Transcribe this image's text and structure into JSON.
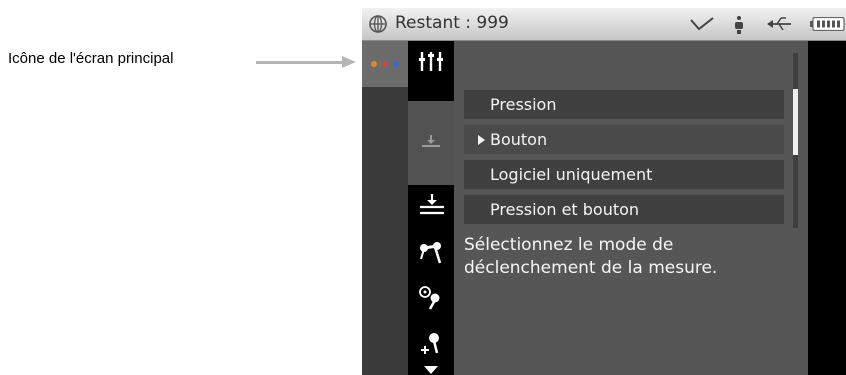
{
  "callout": {
    "label": "Icône de l'écran principal"
  },
  "statusbar": {
    "title": "Restant : 999",
    "icons": [
      "globe-icon",
      "check-icon",
      "sensor-icon",
      "usb-icon",
      "battery-icon"
    ]
  },
  "toolbar": {
    "home_icon": "three-dots-icon",
    "dot_colors": [
      "#e08a2e",
      "#c94848",
      "#3d66c8"
    ]
  },
  "subbar": {
    "icons": [
      "sliders-icon",
      "trend-icon",
      "trigger-icon",
      "trigger-selected-icon",
      "probe-icon",
      "probe-settings-icon",
      "probe-add-icon",
      "down-arrow-icon"
    ]
  },
  "menu": {
    "items": [
      "Pression",
      "Bouton",
      "Logiciel uniquement",
      "Pression et bouton"
    ],
    "selected_index": 1
  },
  "description": "Sélectionnez le mode de déclenchement de la mesure.",
  "scroll": {
    "position": 0.2
  }
}
